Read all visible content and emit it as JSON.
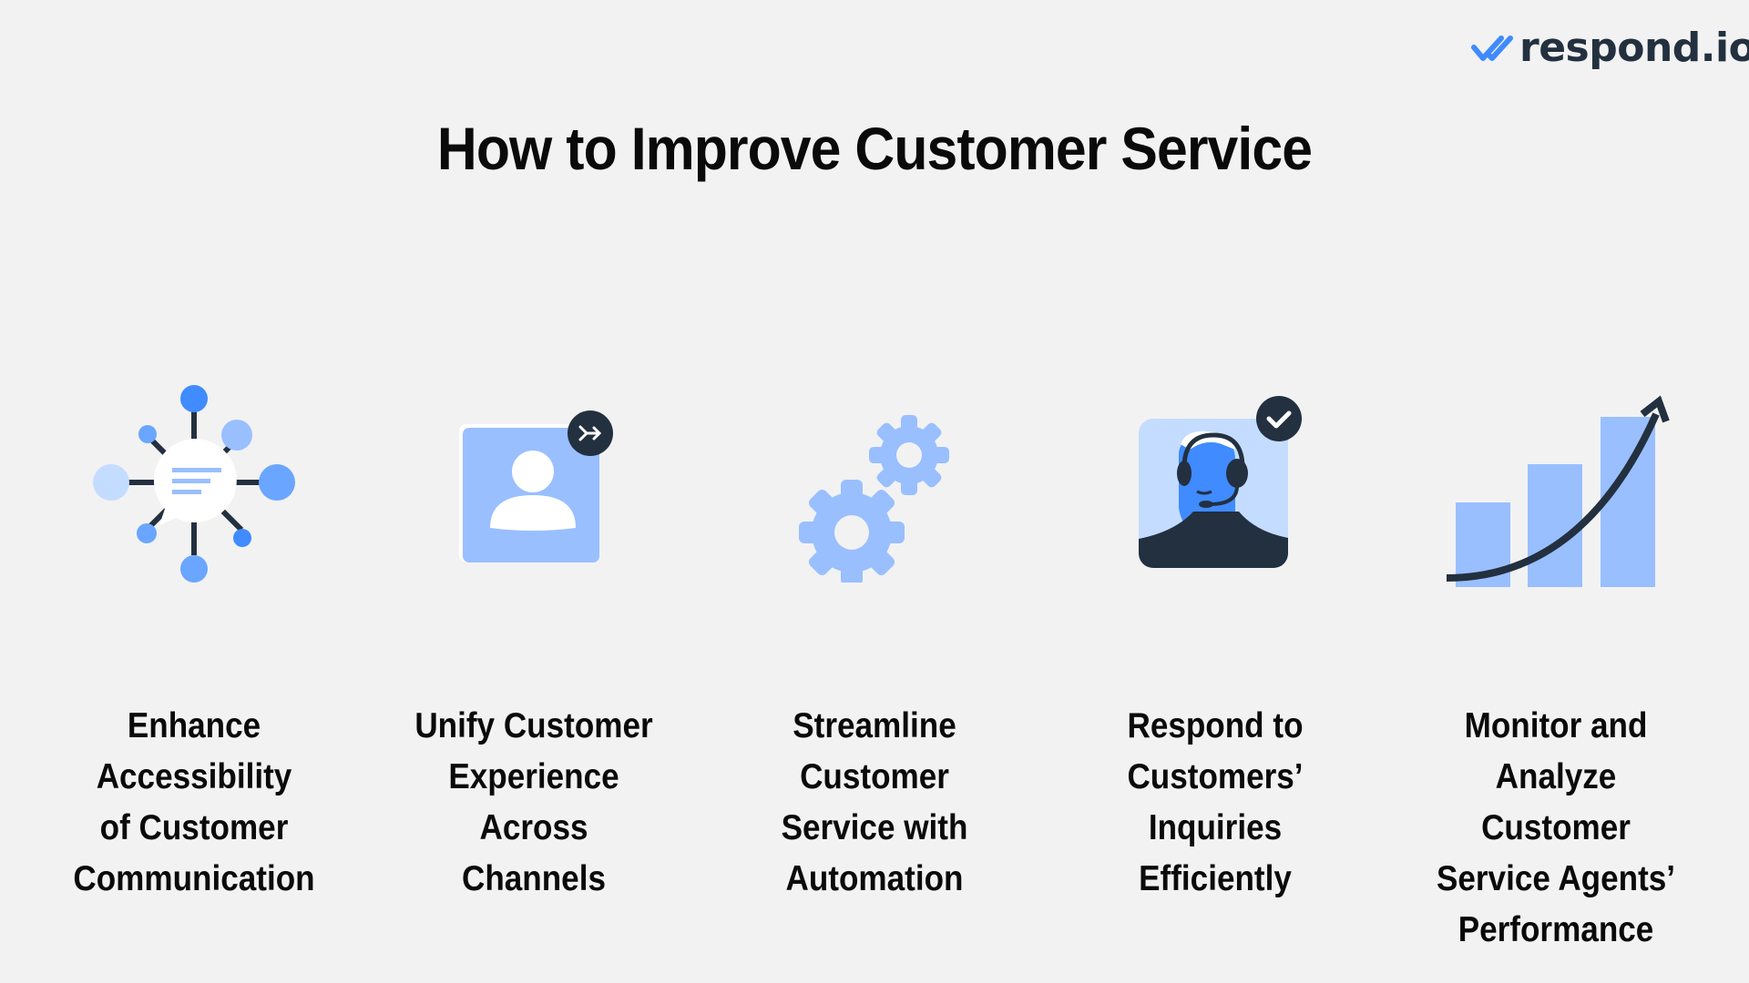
{
  "brand": {
    "name": "respond.io",
    "icon": "double-check-icon",
    "color_primary": "#23303f",
    "color_accent": "#3f8bff"
  },
  "title": "How to Improve Customer Service",
  "colors": {
    "background": "#f2f2f2",
    "blue_bright": "#3f8bff",
    "blue_mid": "#6aa6ff",
    "blue_light": "#99bfff",
    "blue_pale": "#c4dcff",
    "navy": "#23303f"
  },
  "steps": [
    {
      "icon": "network-chat-icon",
      "lines": [
        "Enhance",
        "Accessibility",
        "of Customer",
        "Communication"
      ]
    },
    {
      "icon": "user-profile-merge-icon",
      "lines": [
        "Unify Customer",
        "Experience",
        "Across",
        "Channels"
      ]
    },
    {
      "icon": "gears-icon",
      "lines": [
        "Streamline",
        "Customer",
        "Service with",
        "Automation"
      ]
    },
    {
      "icon": "agent-headset-check-icon",
      "lines": [
        "Respond to",
        "Customers’",
        "Inquiries",
        "Efficiently"
      ]
    },
    {
      "icon": "growth-chart-icon",
      "lines": [
        "Monitor and",
        "Analyze",
        "Customer",
        "Service Agents’",
        "Performance"
      ]
    }
  ]
}
